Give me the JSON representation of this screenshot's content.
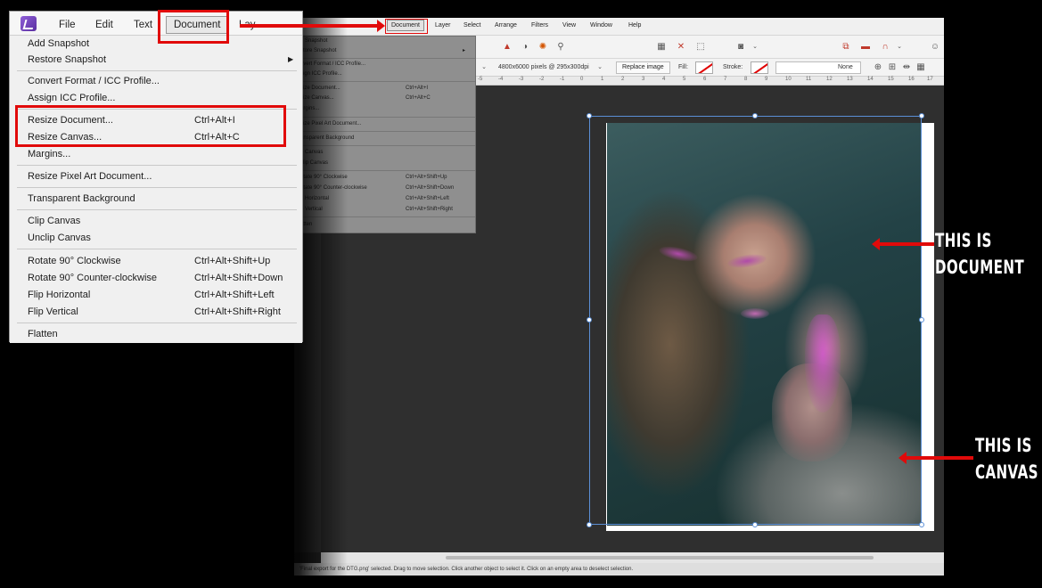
{
  "zoom_menu": {
    "top_items": [
      "File",
      "Edit",
      "Text",
      "Document",
      "Lay"
    ],
    "items": [
      {
        "label": "Add Snapshot",
        "shortcut": "",
        "submenu": false
      },
      {
        "label": "Restore Snapshot",
        "shortcut": "",
        "submenu": true
      },
      {
        "label": "Convert Format / ICC Profile...",
        "shortcut": "",
        "submenu": false
      },
      {
        "label": "Assign ICC Profile...",
        "shortcut": "",
        "submenu": false
      },
      {
        "label": "Resize Document...",
        "shortcut": "Ctrl+Alt+I",
        "submenu": false
      },
      {
        "label": "Resize Canvas...",
        "shortcut": "Ctrl+Alt+C",
        "submenu": false
      },
      {
        "label": "Margins...",
        "shortcut": "",
        "submenu": false
      },
      {
        "label": "Resize Pixel Art Document...",
        "shortcut": "",
        "submenu": false
      },
      {
        "label": "Transparent Background",
        "shortcut": "",
        "submenu": false
      },
      {
        "label": "Clip Canvas",
        "shortcut": "",
        "submenu": false
      },
      {
        "label": "Unclip Canvas",
        "shortcut": "",
        "submenu": false
      },
      {
        "label": "Rotate 90° Clockwise",
        "shortcut": "Ctrl+Alt+Shift+Up",
        "submenu": false
      },
      {
        "label": "Rotate 90° Counter-clockwise",
        "shortcut": "Ctrl+Alt+Shift+Down",
        "submenu": false
      },
      {
        "label": "Flip Horizontal",
        "shortcut": "Ctrl+Alt+Shift+Left",
        "submenu": false
      },
      {
        "label": "Flip Vertical",
        "shortcut": "Ctrl+Alt+Shift+Right",
        "submenu": false
      },
      {
        "label": "Flatten",
        "shortcut": "",
        "submenu": false
      }
    ]
  },
  "app": {
    "menubar": [
      "Document",
      "Layer",
      "Select",
      "Arrange",
      "Filters",
      "View",
      "Window",
      "Help"
    ],
    "background_menu": [
      {
        "label": "d Snapshot",
        "shortcut": ""
      },
      {
        "label": "store Snapshot",
        "shortcut": ""
      },
      {
        "label": "nvert Format / ICC Profile...",
        "shortcut": ""
      },
      {
        "label": "sign ICC Profile...",
        "shortcut": ""
      },
      {
        "label": "size Document...",
        "shortcut": "Ctrl+Alt+I"
      },
      {
        "label": "size Canvas...",
        "shortcut": "Ctrl+Alt+C"
      },
      {
        "label": "argins...",
        "shortcut": ""
      },
      {
        "label": "size Pixel Art Document...",
        "shortcut": ""
      },
      {
        "label": "ansparent Background",
        "shortcut": ""
      },
      {
        "label": "p Canvas",
        "shortcut": ""
      },
      {
        "label": "clip Canvas",
        "shortcut": ""
      },
      {
        "label": "otate 90° Clockwise",
        "shortcut": "Ctrl+Alt+Shift+Up"
      },
      {
        "label": "otate 90° Counter-clockwise",
        "shortcut": "Ctrl+Alt+Shift+Down"
      },
      {
        "label": "p Horizontal",
        "shortcut": "Ctrl+Alt+Shift+Left"
      },
      {
        "label": "p Vertical",
        "shortcut": "Ctrl+Alt+Shift+Right"
      },
      {
        "label": "atten",
        "shortcut": ""
      }
    ],
    "context_toolbar": {
      "image_info": "4800x6000 pixels @ 295x300dpi",
      "replace_button": "Replace image",
      "fill_label": "Fill:",
      "stroke_label": "Stroke:",
      "stroke_value": "None"
    },
    "ruler_ticks": [
      "0",
      "-5",
      "-4",
      "-3",
      "-2",
      "-1",
      "0",
      "1",
      "2",
      "3",
      "4",
      "5",
      "6",
      "7",
      "8",
      "9",
      "10",
      "11",
      "12",
      "13",
      "14",
      "15",
      "16",
      "17"
    ],
    "status_text": "'Final export for the DTG.png' selected. Drag to move selection. Click another object to select it. Click on an empty area to deselect selection."
  },
  "annotations": {
    "document_line1": "THIS IS",
    "document_line2": "DOCUMENT",
    "canvas_line1": "THIS IS",
    "canvas_line2": "CANVAS"
  },
  "colors": {
    "highlight": "#e10a0a",
    "selection": "#5b8fd6"
  }
}
